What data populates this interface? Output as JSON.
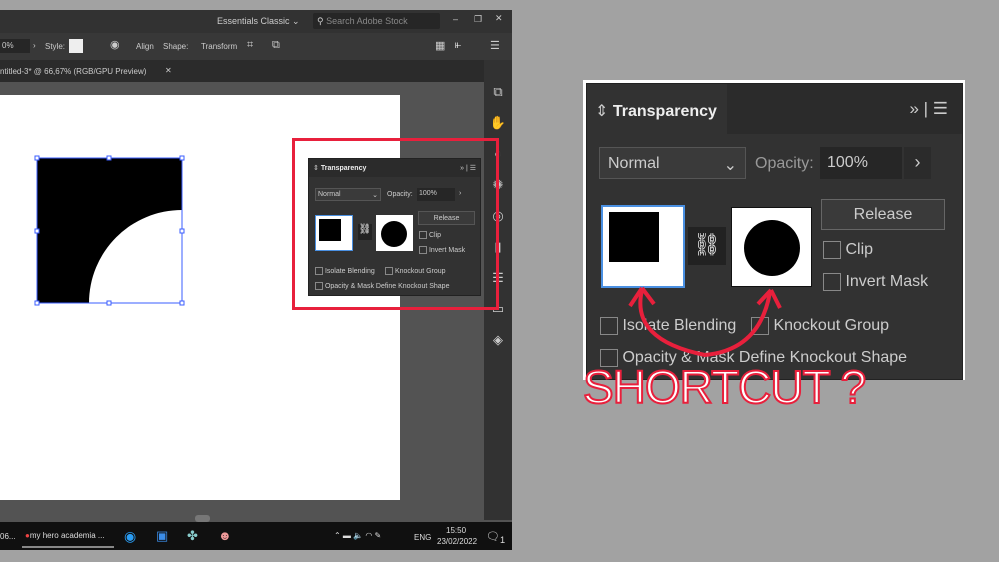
{
  "app": {
    "workspace": "Essentials Classic",
    "search_placeholder": "Search Adobe Stock",
    "toolbar": {
      "zoom_value": "0%",
      "style_label": "Style:",
      "align": "Align",
      "shape": "Shape:",
      "transform": "Transform"
    },
    "doc_tab": "ntitled-3* @ 66,67% (RGB/GPU Preview)"
  },
  "small_panel": {
    "title": "Transparency",
    "blend": "Normal",
    "opacity_label": "Opacity:",
    "opacity": "100%",
    "release": "Release",
    "clip": "Clip",
    "invert_mask": "Invert Mask",
    "isolate": "Isolate Blending",
    "knockout": "Knockout Group",
    "opacity_mask": "Opacity & Mask Define Knockout Shape"
  },
  "big_panel": {
    "title": "Transparency",
    "blend": "Normal",
    "opacity_label": "Opacity:",
    "opacity": "100%",
    "release": "Release",
    "clip": "Clip",
    "invert_mask": "Invert Mask",
    "isolate": "Isolate Blending",
    "knockout": "Knockout Group",
    "opacity_mask": "Opacity & Mask Define Knockout Shape"
  },
  "annotation": {
    "text": "SHORTCUT ?",
    "color": "#e8203c"
  },
  "taskbar": {
    "left_item": "06...",
    "chrome_item": "my hero academia ...",
    "lang": "ENG",
    "time": "15:50",
    "date": "23/02/2022",
    "notif_count": "1"
  }
}
